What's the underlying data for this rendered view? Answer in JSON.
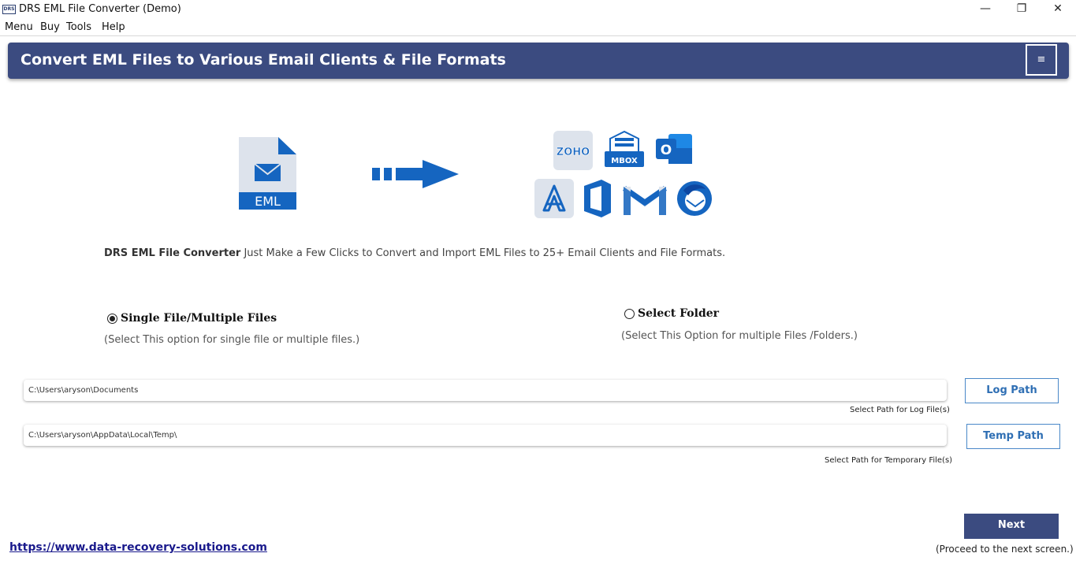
{
  "window": {
    "logo_text": "DRS",
    "title": "DRS EML File Converter (Demo)",
    "min_glyph": "—",
    "max_glyph": "❐",
    "close_glyph": "✕"
  },
  "menu": [
    "Menu",
    "Buy",
    "Tools",
    "Help"
  ],
  "banner": {
    "title": "Convert EML Files to Various Email Clients & File Formats",
    "menu_glyph": "≡"
  },
  "illustration": {
    "source_label": "EML",
    "targets": [
      "zoho-icon",
      "mbox-icon",
      "outlook-icon",
      "pdf-icon",
      "office365-icon",
      "gmail-icon",
      "thunderbird-icon"
    ],
    "zoho_text": "ZOHO",
    "mbox_text": "MBOX",
    "outlook_letter": "O"
  },
  "description": {
    "product": "DRS EML File Converter",
    "text": " Just Make a Few Clicks to Convert and Import EML Files to 25+ Email Clients and File Formats."
  },
  "options": {
    "single": {
      "label": "Single File/Multiple Files",
      "hint": "(Select This option for single file or multiple files.)",
      "selected": true
    },
    "folder": {
      "label": "Select Folder",
      "hint": "(Select This Option for multiple Files /Folders.)",
      "selected": false
    }
  },
  "paths": {
    "log": {
      "value": "C:\\Users\\aryson\\Documents",
      "label": "Select Path for Log File(s)",
      "button": "Log Path"
    },
    "temp": {
      "value": "C:\\Users\\aryson\\AppData\\Local\\Temp\\",
      "label": "Select Path for Temporary File(s)",
      "button": "Temp Path"
    }
  },
  "next": {
    "label": "Next",
    "hint": "(Proceed to the next screen.)"
  },
  "footer_link": "https://www.data-recovery-solutions.com",
  "colors": {
    "brand": "#3b4b80",
    "accent_blue": "#1565c0",
    "button_border": "#4a88c8"
  }
}
